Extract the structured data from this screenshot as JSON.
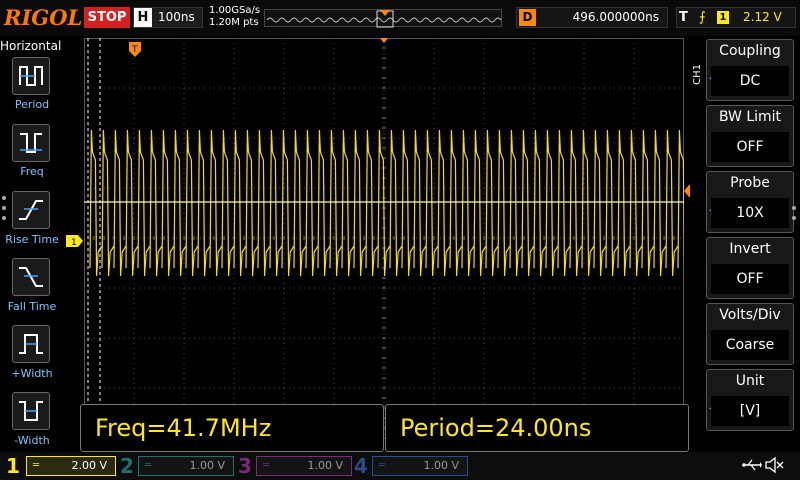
{
  "brand": "RIGOL",
  "run_status": "STOP",
  "horizontal": {
    "letter": "H",
    "timebase": "100ns",
    "sample_rate": "1.00GSa/s",
    "memory_depth": "1.20M pts"
  },
  "delay": {
    "letter": "D",
    "value": "496.000000ns"
  },
  "trigger": {
    "letter": "T",
    "edge_symbol": "⨍",
    "source": "1",
    "level": "2.12 V"
  },
  "left_menu": {
    "title": "Horizontal",
    "items": [
      {
        "label": "Period",
        "icon": "period-icon"
      },
      {
        "label": "Freq",
        "icon": "freq-icon"
      },
      {
        "label": "Rise Time",
        "icon": "rise-time-icon"
      },
      {
        "label": "Fall Time",
        "icon": "fall-time-icon"
      },
      {
        "label": "+Width",
        "icon": "positive-width-icon"
      },
      {
        "label": "-Width",
        "icon": "negative-width-icon"
      }
    ]
  },
  "right_menu": {
    "channel_tag": "CH1",
    "items": [
      {
        "title": "Coupling",
        "value": "DC"
      },
      {
        "title": "BW Limit",
        "value": "OFF"
      },
      {
        "title": "Probe",
        "value": "10X"
      },
      {
        "title": "Invert",
        "value": "OFF"
      },
      {
        "title": "Volts/Div",
        "value": "Coarse"
      },
      {
        "title": "Unit",
        "value": "[V]"
      }
    ]
  },
  "markers": {
    "channel1": "1",
    "trigger": "T"
  },
  "measurements": [
    {
      "text": "Freq=41.7MHz"
    },
    {
      "text": "Period=24.00ns"
    }
  ],
  "channels": [
    {
      "number": "1",
      "coupling_symbol": "═",
      "scale": "2.00 V",
      "color": "#ffe81a",
      "active": true
    },
    {
      "number": "2",
      "coupling_symbol": "═",
      "scale": "1.00 V",
      "color": "#00d8d8",
      "active": false
    },
    {
      "number": "3",
      "coupling_symbol": "═",
      "scale": "1.00 V",
      "color": "#e040e0",
      "active": false
    },
    {
      "number": "4",
      "coupling_symbol": "═",
      "scale": "1.00 V",
      "color": "#3a7cff",
      "active": false
    }
  ],
  "colors": {
    "trace": "#ffe81a",
    "accent_orange": "#ff8a00",
    "menu_label": "#7fc4ff",
    "stop_red": "#d42020"
  },
  "waveform": {
    "frequency_mhz": 41.7,
    "period_ns": 24.0,
    "timebase_ns_per_div": 100
  }
}
